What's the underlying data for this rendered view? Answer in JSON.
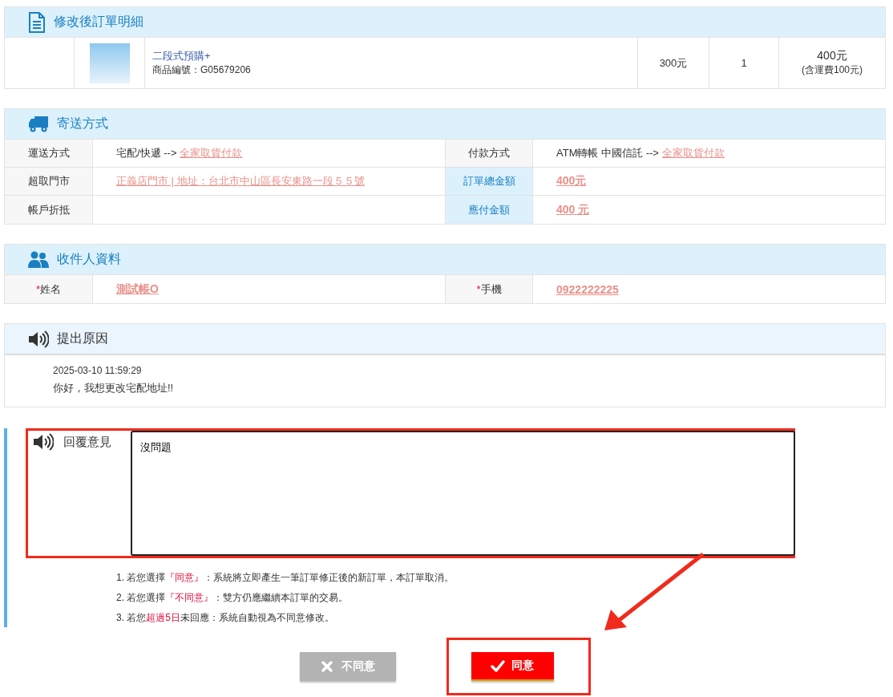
{
  "order": {
    "title": "修改後訂單明細",
    "item": {
      "name": "二段式預購+",
      "code": "商品編號：G05679206",
      "price": "300元",
      "quantity": "1",
      "total": "400元",
      "total_note": "(含運費100元)"
    }
  },
  "shipping": {
    "title": "寄送方式",
    "rows": [
      {
        "label": "運送方式",
        "value": "宅配/快遞 -->",
        "link": "全家取貨付款",
        "label2": "付款方式",
        "label2_accent": false,
        "value2": "ATM轉帳 中國信託 -->",
        "link2": "全家取貨付款",
        "link2_bold": false
      },
      {
        "label": "超取門市",
        "link": "正義店門市 | 地址：台北市中山區長安東路一段５５號",
        "label2": "訂單總金額",
        "label2_accent": true,
        "link2": "400元",
        "link2_bold": true
      },
      {
        "label": "帳戶折抵",
        "label2": "應付金額",
        "label2_accent": true,
        "link2": "400 元",
        "link2_bold": true
      }
    ]
  },
  "recipient": {
    "title": "收件人資料",
    "fields": [
      {
        "required_mark": "*",
        "label": "姓名",
        "value": "測試帳O"
      },
      {
        "required_mark": "*",
        "label": "手機",
        "value": "0922222225"
      }
    ]
  },
  "reason": {
    "title": "提出原因",
    "time": "2025-03-10 11:59:29",
    "message": "你好，我想更改宅配地址!!"
  },
  "reply": {
    "label": "回覆意見",
    "value": "沒問題",
    "highlighted": true
  },
  "notes": [
    [
      {
        "text": "1. 若您選擇"
      },
      {
        "text": "『同意』",
        "highlight": true
      },
      {
        "text": "：系統將立即產生一筆訂單修正後的新訂單，本訂單取消。"
      }
    ],
    [
      {
        "text": "2. 若您選擇"
      },
      {
        "text": "『不同意』",
        "highlight": true
      },
      {
        "text": "：雙方仍應繼續本訂單的交易。"
      }
    ],
    [
      {
        "text": "3. 若您"
      },
      {
        "text": "超過5日",
        "highlight": true
      },
      {
        "text": "未回應：系統自動視為不同意修改。"
      }
    ]
  ],
  "buttons": [
    {
      "kind": "reject",
      "label": "不同意",
      "highlighted": false
    },
    {
      "kind": "accept",
      "label": "同意",
      "highlighted": true
    }
  ],
  "pointer_arrow": true
}
